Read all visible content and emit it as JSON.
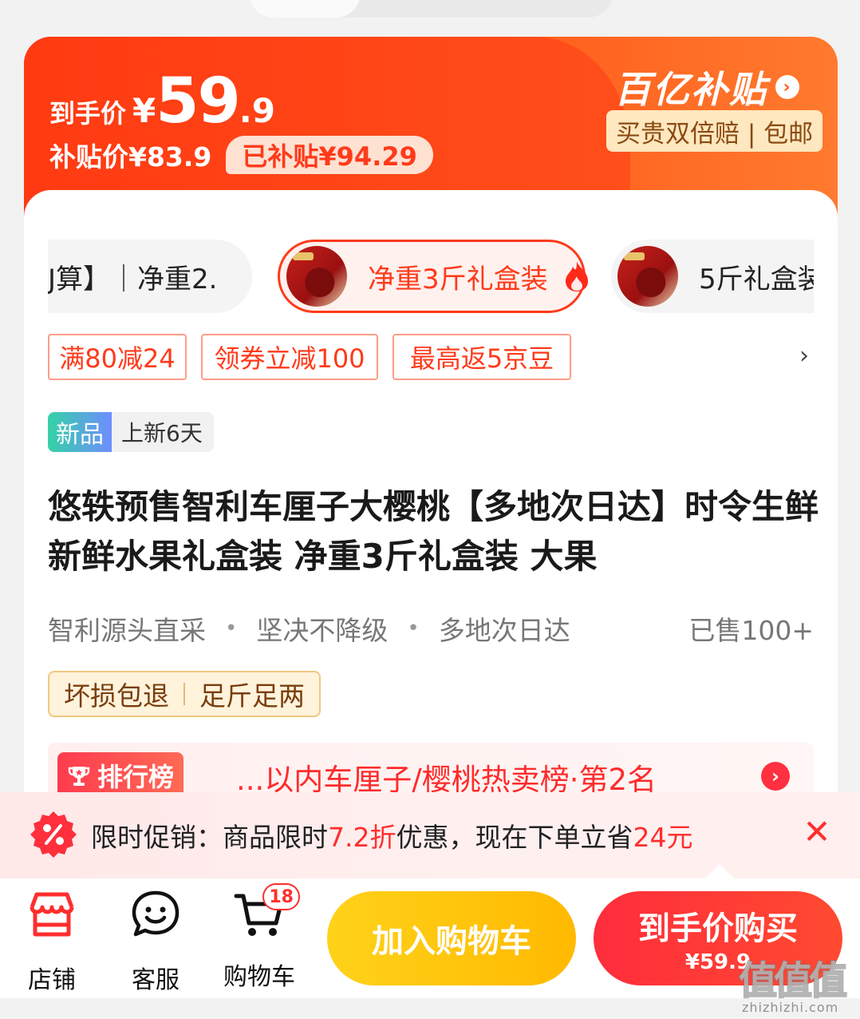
{
  "colors": {
    "accent": "#ff3a1a",
    "banner": "#ff4f1a",
    "add_cart": "#ffc20d",
    "buy": "#ff2d3c"
  },
  "price_banner": {
    "handprice_label": "到手价",
    "currency": "¥",
    "price_int": "59",
    "price_dec": ".9",
    "subsidy_label": "补贴价¥83.9",
    "subsidy_badge": "已补贴¥94.29",
    "program_logo": "百亿补贴",
    "program_tags": "买贵双倍赔 | 包邮"
  },
  "variants": [
    {
      "label": "J算】｜净重2.",
      "selected": false,
      "has_thumb": false
    },
    {
      "label": "净重3斤礼盒装",
      "selected": true,
      "has_thumb": true,
      "hot": true
    },
    {
      "label": "5斤礼盒装",
      "selected": false,
      "has_thumb": true
    }
  ],
  "coupons": [
    "满80减24",
    "领券立减100",
    "最高返5京豆"
  ],
  "new_tag": {
    "badge": "新品",
    "text": "上新6天"
  },
  "title": "悠轶预售智利车厘子大樱桃【多地次日达】时令生鲜新鲜水果礼盒装 净重3斤礼盒装 大果",
  "features": [
    "智利源头直采",
    "坚决不降级",
    "多地次日达"
  ],
  "feature_separator": "•",
  "sold": "已售100+",
  "guarantees": [
    "坏损包退",
    "足斤足两"
  ],
  "ranking": {
    "badge": "排行榜",
    "text": "...以内车厘子/樱桃热卖榜·第2名"
  },
  "promo": {
    "prefix": "限时促销：商品限时",
    "discount": "7.2折",
    "middle": "优惠，现在下单立省",
    "save": "24元"
  },
  "bottom_bar": {
    "store": "店铺",
    "service": "客服",
    "cart": "购物车",
    "cart_count": "18",
    "add_to_cart": "加入购物车",
    "buy_now": "到手价购买",
    "buy_price": "¥59.9"
  },
  "watermark": {
    "chars": "值值值",
    "url": "zhizhizhi.com"
  }
}
